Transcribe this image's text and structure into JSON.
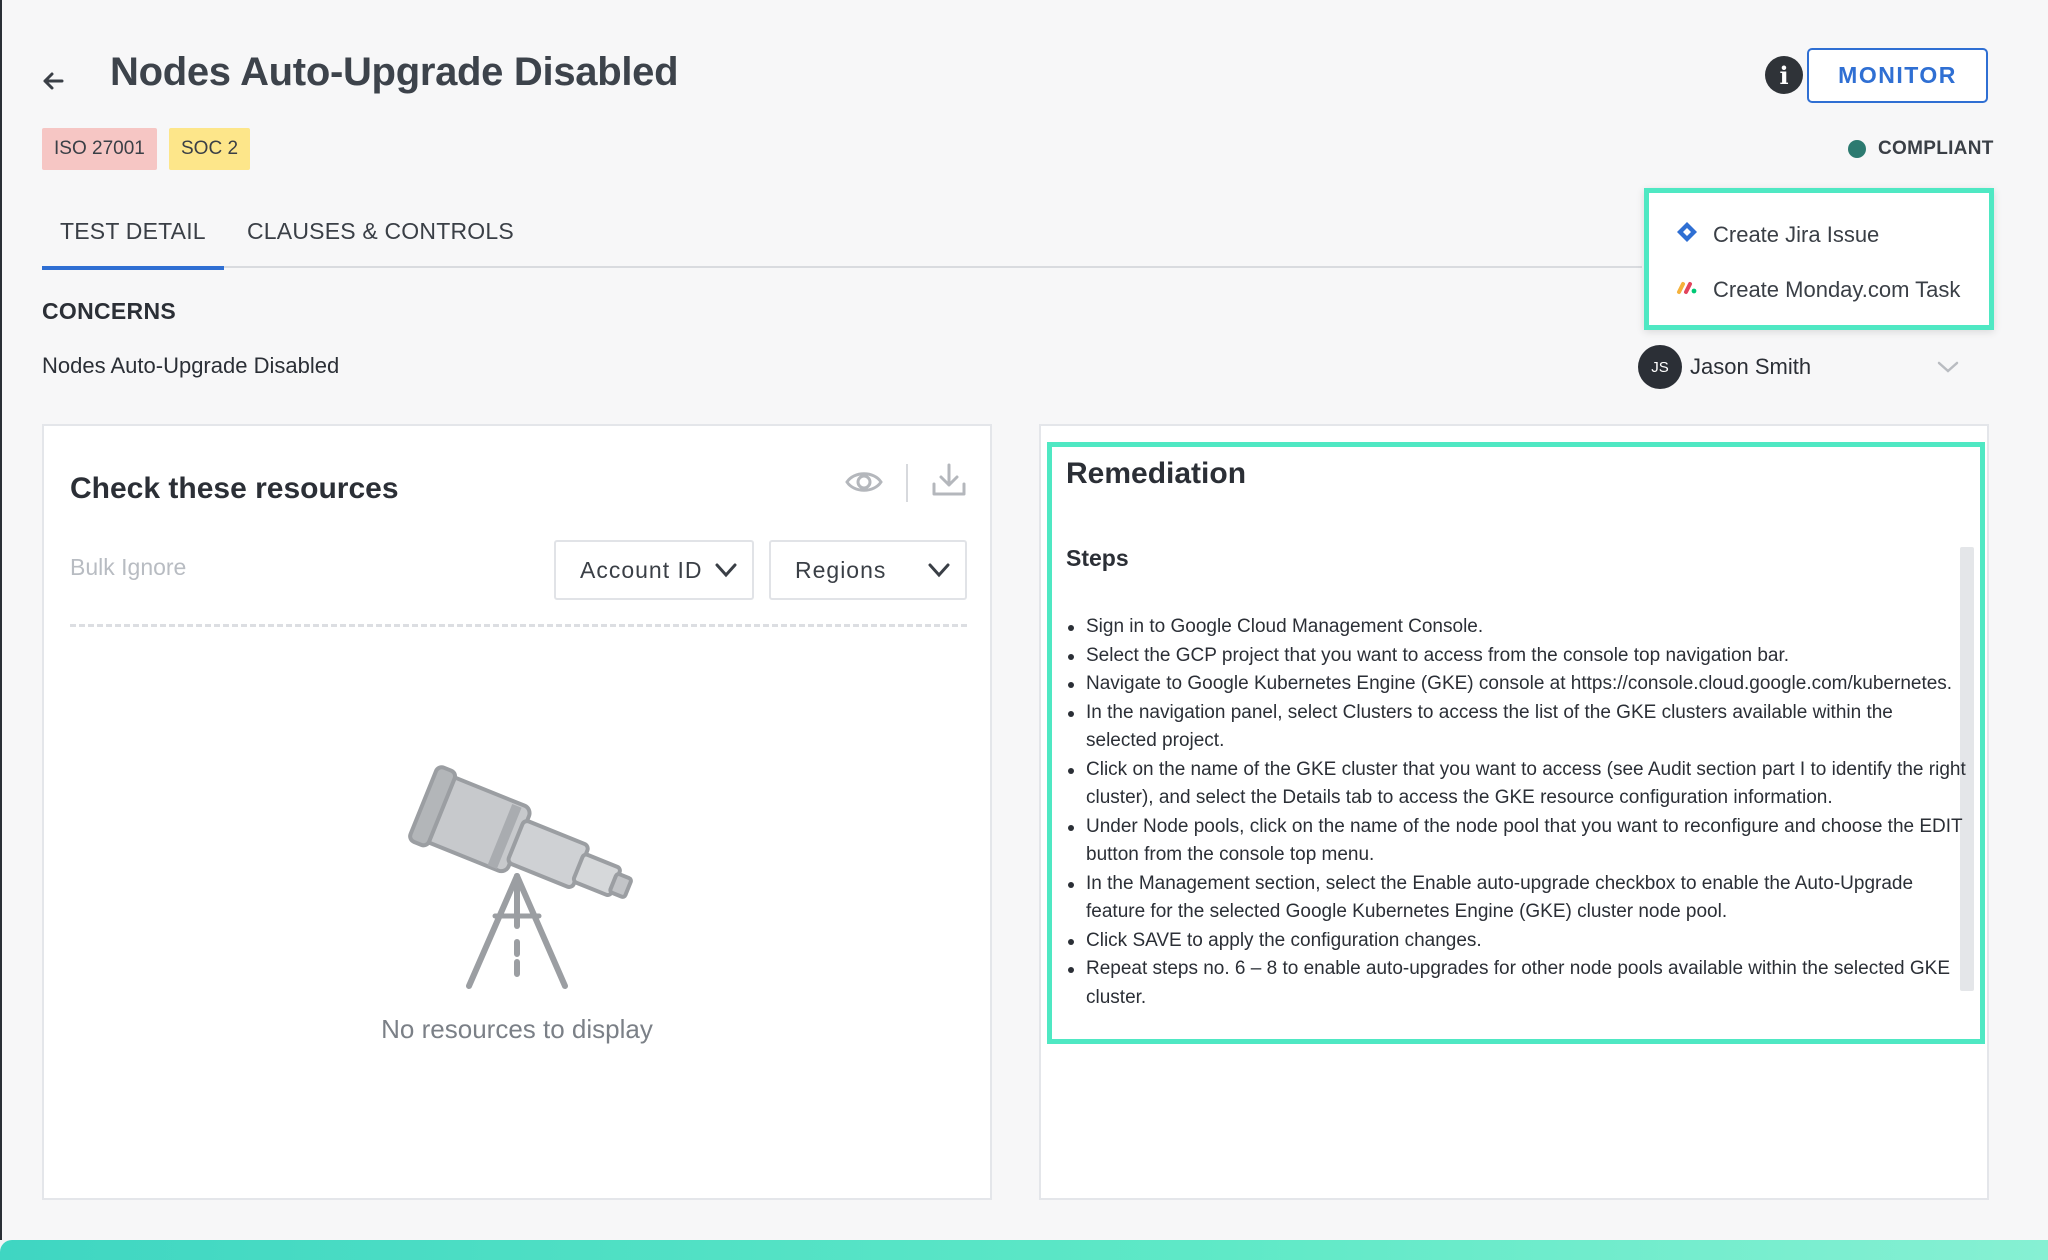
{
  "header": {
    "title": "Nodes Auto-Upgrade Disabled",
    "badges": [
      "ISO 27001",
      "SOC 2"
    ],
    "monitor_label": "MONITOR",
    "status_label": "COMPLIANT",
    "status_color": "#2c7a70"
  },
  "tabs": [
    {
      "label": "TEST DETAIL",
      "active": true
    },
    {
      "label": "CLAUSES & CONTROLS",
      "active": false
    }
  ],
  "ticket_menu": {
    "items": [
      {
        "label": "Create Jira Issue",
        "icon": "jira-icon"
      },
      {
        "label": "Create Monday.com Task",
        "icon": "monday-icon"
      }
    ]
  },
  "concerns": {
    "heading": "CONCERNS",
    "text": "Nodes Auto-Upgrade Disabled"
  },
  "assignee": {
    "initials": "JS",
    "name": "Jason Smith"
  },
  "resources": {
    "title": "Check these resources",
    "bulk_ignore": "Bulk Ignore",
    "filters": [
      "Account ID",
      "Regions"
    ],
    "empty_text": "No resources to display"
  },
  "remediation": {
    "title": "Remediation",
    "steps_heading": "Steps",
    "steps": [
      "Sign in to Google Cloud Management Console.",
      "Select the GCP project that you want to access from the console top navigation bar.",
      "Navigate to Google Kubernetes Engine (GKE) console at https://console.cloud.google.com/kubernetes.",
      "In the navigation panel, select Clusters to access the list of the GKE clusters available within the selected project.",
      "Click on the name of the GKE cluster that you want to access (see Audit section part I to identify the right cluster), and select the Details tab to access the GKE resource configuration information.",
      "Under Node pools, click on the name of the node pool that you want to reconfigure and choose the EDIT button from the console top menu.",
      "In the Management section, select the Enable auto-upgrade checkbox to enable the Auto-Upgrade feature for the selected Google Kubernetes Engine (GKE) cluster node pool.",
      "Click SAVE to apply the configuration changes.",
      "Repeat steps no. 6 – 8 to enable auto-upgrades for other node pools available within the selected GKE cluster."
    ]
  },
  "colors": {
    "accent": "#2f6fd3",
    "highlight": "#4fe8c3"
  }
}
